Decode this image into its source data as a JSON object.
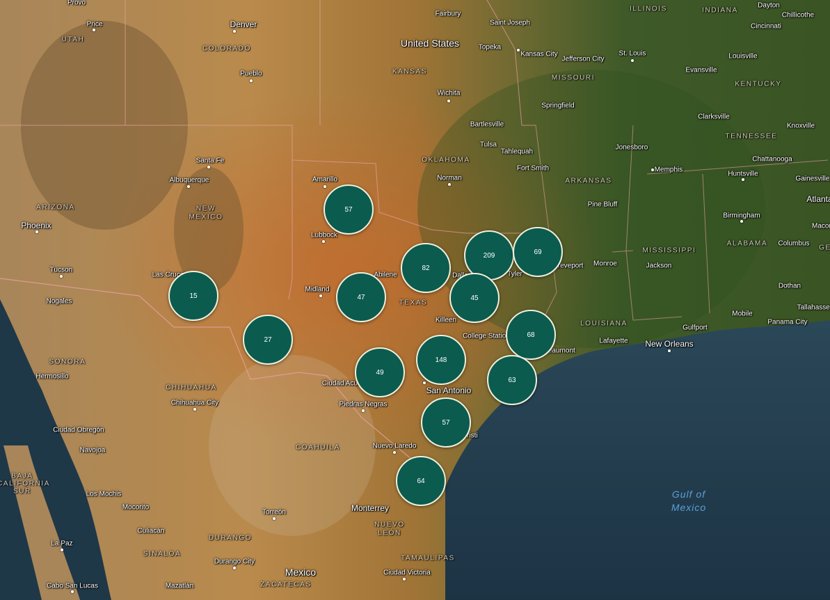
{
  "colors": {
    "cluster_fill": "#0b5b4f",
    "cluster_border": "#f1f0dc",
    "water": "#1f3b4d",
    "land": "#9a7a45"
  },
  "clusters": [
    {
      "count": "57"
    },
    {
      "count": "15"
    },
    {
      "count": "27"
    },
    {
      "count": "47"
    },
    {
      "count": "82"
    },
    {
      "count": "209"
    },
    {
      "count": "69"
    },
    {
      "count": "45"
    },
    {
      "count": "68"
    },
    {
      "count": "148"
    },
    {
      "count": "49"
    },
    {
      "count": "63"
    },
    {
      "count": "57"
    },
    {
      "count": "64"
    }
  ],
  "cities": [
    "Provo",
    "Price",
    "Denver",
    "Pueblo",
    "Santa Fe",
    "Albuquerque",
    "Phoenix",
    "Tucson",
    "Nogales",
    "Las Cruces",
    "Hermosillo",
    "Chihuahua City",
    "Ciudad Obregón",
    "Navojoa",
    "Los Mochis",
    "Mocorito",
    "Culiacán",
    "La Paz",
    "Cabo San Lucas",
    "Mazatlán",
    "Durango City",
    "Torreón",
    "Monterrey",
    "Ciudad Victoria",
    "Nuevo Laredo",
    "Piedras Negras",
    "Ciudad Acuña",
    "Amarillo",
    "Lubbock",
    "Midland",
    "Abilene",
    "Killeen",
    "College Station",
    "San Antonio",
    "Corpus Christi",
    "Fairbury",
    "Saint Joseph",
    "Topeka",
    "Kansas City",
    "Jefferson City",
    "St. Louis",
    "Wichita",
    "Springfield",
    "Bartlesville",
    "Tulsa",
    "Tahlequah",
    "Fort Smith",
    "Norman",
    "Jonesboro",
    "Memphis",
    "Jackson",
    "Pine Bluff",
    "Monroe",
    "Shreveport",
    "Tyler",
    "Lafayette",
    "New Orleans",
    "Gulfport",
    "Mobile",
    "Dothan",
    "Tallahassee",
    "Panama City",
    "Birmingham",
    "Columbus",
    "Huntsville",
    "Chattanooga",
    "Knoxville",
    "Clarksville",
    "Evansville",
    "Louisville",
    "Cincinnati",
    "Dayton",
    "Chillicothe",
    "Gainesville",
    "Atlanta",
    "Macon",
    "Beaumont",
    "Dallas"
  ],
  "countries": [
    "United States",
    "Mexico"
  ],
  "regions": [
    "UTAH",
    "COLORADO",
    "KANSAS",
    "MISSOURI",
    "ILLINOIS",
    "INDIANA",
    "KENTUCKY",
    "TENNESSEE",
    "OKLAHOMA",
    "ARKANSAS",
    "MISSISSIPPI",
    "ALABAMA",
    "LOUISIANA",
    "TEXAS",
    "NEW",
    "MEXICO",
    "ARIZONA",
    "SONORA",
    "CHIHUAHUA",
    "COAHUILA",
    "NUEVO",
    "LEÓN",
    "DURANGO",
    "SINALOA",
    "TAMAULIPAS",
    "ZACATECAS",
    "BAJA",
    "CALIFORNIA",
    "SUR",
    "GE"
  ],
  "water_labels": [
    "Gulf of",
    "Mexico"
  ]
}
